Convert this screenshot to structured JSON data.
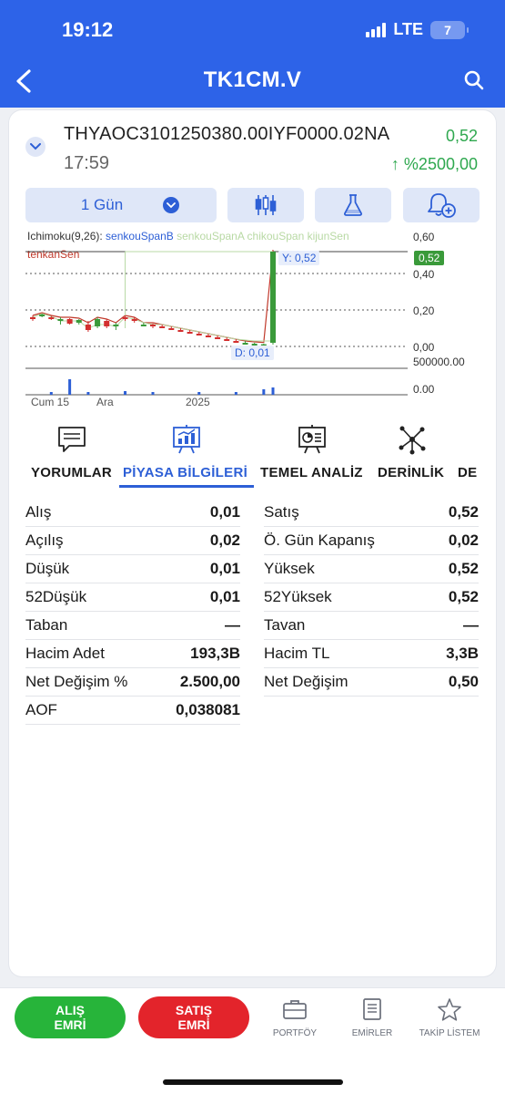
{
  "status": {
    "time": "19:12",
    "network": "LTE",
    "battery": "7"
  },
  "nav": {
    "title": "TK1CM.V"
  },
  "instrument": {
    "symbol": "THYAOC3101250380.00IYF0000.02NA",
    "time": "17:59",
    "price": "0,52",
    "change": "↑ %2500,00"
  },
  "toolbar": {
    "period": "1 Gün"
  },
  "chart": {
    "indicator_prefix": "Ichimoku(9,26):",
    "indicators": [
      "senkouSpanB",
      "senkouSpanA",
      "chikouSpan",
      "kijunSen",
      "tenkanSen"
    ],
    "last_label": "Y: 0,52",
    "low_label": "D: 0,01",
    "last_badge": "0,52",
    "y_ticks": [
      "0,60",
      "0,40",
      "0,20",
      "0,00"
    ],
    "volume_ticks": [
      "500000.00",
      "0.00"
    ],
    "x_ticks": [
      "Cum 15",
      "Ara",
      "2025"
    ],
    "colors": {
      "up": "#3a9a3a",
      "down": "#d32f2f",
      "senkouSpanB": "#2d5fd6",
      "senkouSpanA": "#b8d9a4",
      "tenkanSen": "#c0392b"
    }
  },
  "chart_data": {
    "type": "candlestick",
    "ylim": [
      0,
      0.6
    ],
    "x_ticks": [
      "Cum 15",
      "Ara",
      "2025"
    ],
    "candles": [
      {
        "o": 0.16,
        "h": 0.17,
        "l": 0.14,
        "c": 0.155
      },
      {
        "o": 0.17,
        "h": 0.18,
        "l": 0.16,
        "c": 0.175
      },
      {
        "o": 0.16,
        "h": 0.17,
        "l": 0.145,
        "c": 0.15
      },
      {
        "o": 0.14,
        "h": 0.16,
        "l": 0.12,
        "c": 0.15
      },
      {
        "o": 0.15,
        "h": 0.155,
        "l": 0.12,
        "c": 0.125
      },
      {
        "o": 0.13,
        "h": 0.15,
        "l": 0.12,
        "c": 0.145
      },
      {
        "o": 0.12,
        "h": 0.14,
        "l": 0.08,
        "c": 0.09
      },
      {
        "o": 0.11,
        "h": 0.16,
        "l": 0.1,
        "c": 0.15
      },
      {
        "o": 0.14,
        "h": 0.15,
        "l": 0.1,
        "c": 0.11
      },
      {
        "o": 0.11,
        "h": 0.13,
        "l": 0.09,
        "c": 0.12
      },
      {
        "o": 0.16,
        "h": 0.17,
        "l": 0.14,
        "c": 0.15
      },
      {
        "o": 0.15,
        "h": 0.16,
        "l": 0.13,
        "c": 0.145
      },
      {
        "o": 0.12,
        "h": 0.13,
        "l": 0.11,
        "c": 0.12
      },
      {
        "o": 0.12,
        "h": 0.125,
        "l": 0.1,
        "c": 0.11
      },
      {
        "o": 0.11,
        "h": 0.12,
        "l": 0.1,
        "c": 0.105
      },
      {
        "o": 0.1,
        "h": 0.11,
        "l": 0.09,
        "c": 0.095
      },
      {
        "o": 0.09,
        "h": 0.1,
        "l": 0.08,
        "c": 0.085
      },
      {
        "o": 0.08,
        "h": 0.09,
        "l": 0.07,
        "c": 0.075
      },
      {
        "o": 0.07,
        "h": 0.08,
        "l": 0.06,
        "c": 0.065
      },
      {
        "o": 0.06,
        "h": 0.07,
        "l": 0.05,
        "c": 0.055
      },
      {
        "o": 0.05,
        "h": 0.06,
        "l": 0.04,
        "c": 0.045
      },
      {
        "o": 0.04,
        "h": 0.05,
        "l": 0.03,
        "c": 0.035
      },
      {
        "o": 0.03,
        "h": 0.04,
        "l": 0.02,
        "c": 0.025
      },
      {
        "o": 0.02,
        "h": 0.03,
        "l": 0.015,
        "c": 0.02
      },
      {
        "o": 0.015,
        "h": 0.02,
        "l": 0.01,
        "c": 0.015
      },
      {
        "o": 0.01,
        "h": 0.015,
        "l": 0.01,
        "c": 0.012
      },
      {
        "o": 0.02,
        "h": 0.52,
        "l": 0.01,
        "c": 0.52
      }
    ],
    "last": 0.52,
    "low": 0.01
  },
  "tabs": {
    "comments": "YORUMLAR",
    "market": "PİYASA BİLGİLERİ",
    "fundamental": "TEMEL ANALİZ",
    "depth": "DERİNLİK",
    "more": "DE"
  },
  "info": {
    "left": [
      {
        "label": "Alış",
        "value": "0,01"
      },
      {
        "label": "Açılış",
        "value": "0,02"
      },
      {
        "label": "Düşük",
        "value": "0,01"
      },
      {
        "label": "52Düşük",
        "value": "0,01"
      },
      {
        "label": "Taban",
        "value": "—"
      },
      {
        "label": "Hacim Adet",
        "value": "193,3B"
      },
      {
        "label": "Net Değişim %",
        "value": "2.500,00"
      },
      {
        "label": "AOF",
        "value": "0,038081"
      }
    ],
    "right": [
      {
        "label": "Satış",
        "value": "0,52"
      },
      {
        "label": "Ö. Gün Kapanış",
        "value": "0,02"
      },
      {
        "label": "Yüksek",
        "value": "0,52"
      },
      {
        "label": "52Yüksek",
        "value": "0,52"
      },
      {
        "label": "Tavan",
        "value": "—"
      },
      {
        "label": "Hacim TL",
        "value": "3,3B"
      },
      {
        "label": "Net Değişim",
        "value": "0,50"
      }
    ]
  },
  "bottom": {
    "buy": "ALIŞ EMRİ",
    "sell": "SATIŞ EMRİ",
    "portfolio": "PORTFÖY",
    "orders": "EMİRLER",
    "watchlist": "TAKİP LİSTEM"
  }
}
